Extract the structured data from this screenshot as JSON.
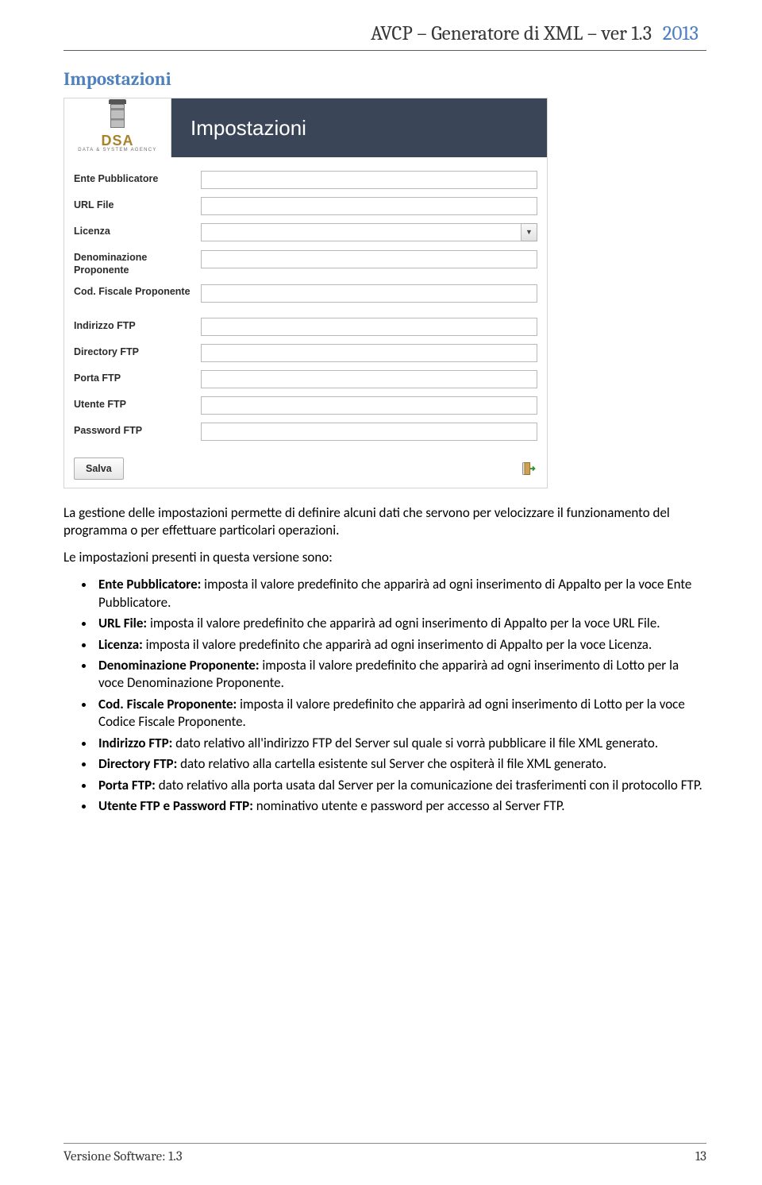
{
  "doc": {
    "header_title": "AVCP – Generatore di XML – ver 1.3",
    "header_year": "2013",
    "footer_left": "Versione Software: 1.3",
    "footer_right": "13"
  },
  "section": {
    "title": "Impostazioni"
  },
  "app": {
    "logo_text": "DSA",
    "logo_sub": "DATA & SYSTEM AGENCY",
    "header_title": "Impostazioni",
    "save_label": "Salva",
    "fields": {
      "ente_pubblicatore": "Ente Pubblicatore",
      "url_file": "URL File",
      "licenza": "Licenza",
      "denominazione_proponente": "Denominazione Proponente",
      "cod_fiscale_proponente": "Cod. Fiscale Proponente",
      "indirizzo_ftp": "Indirizzo FTP",
      "directory_ftp": "Directory FTP",
      "porta_ftp": "Porta FTP",
      "utente_ftp": "Utente FTP",
      "password_ftp": "Password FTP"
    }
  },
  "body": {
    "p1": "La gestione delle impostazioni permette di definire alcuni dati che servono per velocizzare il funzionamento del programma o per effettuare particolari operazioni.",
    "p2": "Le impostazioni presenti in questa versione sono:",
    "items": [
      {
        "term": "Ente Pubblicatore:",
        "text": "  imposta il valore predefinito che apparirà ad ogni inserimento di Appalto per la voce Ente Pubblicatore."
      },
      {
        "term": "URL File:",
        "text": "  imposta il valore predefinito che apparirà ad ogni inserimento di Appalto per la voce URL File."
      },
      {
        "term": "Licenza:",
        "text": "  imposta il valore predefinito che apparirà ad ogni inserimento di Appalto per la voce Licenza."
      },
      {
        "term": "Denominazione Proponente:",
        "text": "  imposta il valore predefinito che apparirà ad ogni inserimento di Lotto per la voce Denominazione Proponente."
      },
      {
        "term": "Cod. Fiscale Proponente:",
        "text": "  imposta il valore predefinito che apparirà ad ogni inserimento di Lotto per la voce Codice Fiscale Proponente."
      },
      {
        "term": "Indirizzo FTP:",
        "text": " dato relativo all'indirizzo FTP del Server sul quale si vorrà pubblicare il file XML generato."
      },
      {
        "term": "Directory FTP:",
        "text": " dato relativo alla cartella esistente sul Server che ospiterà il file XML generato."
      },
      {
        "term": "Porta FTP:",
        "text": " dato relativo alla porta usata dal Server per la comunicazione dei trasferimenti con il protocollo FTP."
      },
      {
        "term": "Utente FTP e Password FTP:",
        "text": " nominativo utente e password per accesso al Server FTP."
      }
    ]
  }
}
